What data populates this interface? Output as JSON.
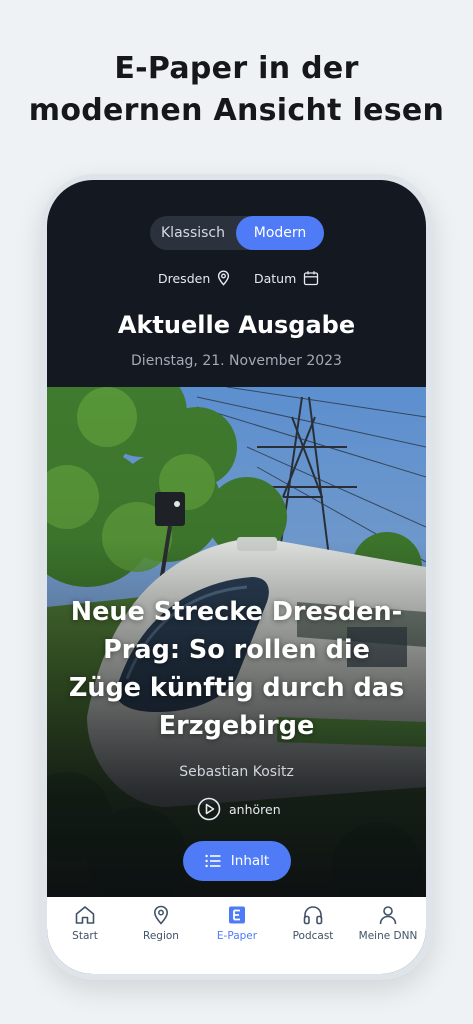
{
  "promo": {
    "line1": "E-Paper in der",
    "line2": "modernen Ansicht lesen"
  },
  "view_toggle": {
    "options": [
      "Klassisch",
      "Modern"
    ],
    "selected": "Modern"
  },
  "filters": {
    "city": "Dresden",
    "date": "Datum"
  },
  "issue": {
    "title": "Aktuelle Ausgabe",
    "date": "Dienstag, 21. November 2023"
  },
  "article": {
    "title": "Neue Strecke Dresden-Prag: So rollen die Züge künftig durch das Erzgebirge",
    "author": "Sebastian Kositz",
    "listen_label": "anhören",
    "contents_label": "Inhalt"
  },
  "tabbar": {
    "items": [
      {
        "label": "Start",
        "icon": "home-icon"
      },
      {
        "label": "Region",
        "icon": "location-pin-icon"
      },
      {
        "label": "E-Paper",
        "icon": "epaper-icon"
      },
      {
        "label": "Podcast",
        "icon": "headphones-icon"
      },
      {
        "label": "Meine DNN",
        "icon": "user-icon"
      }
    ],
    "active": "E-Paper"
  },
  "colors": {
    "accent": "#4f7cf6",
    "screen_bg": "#141821",
    "page_bg": "#eef2f5"
  }
}
